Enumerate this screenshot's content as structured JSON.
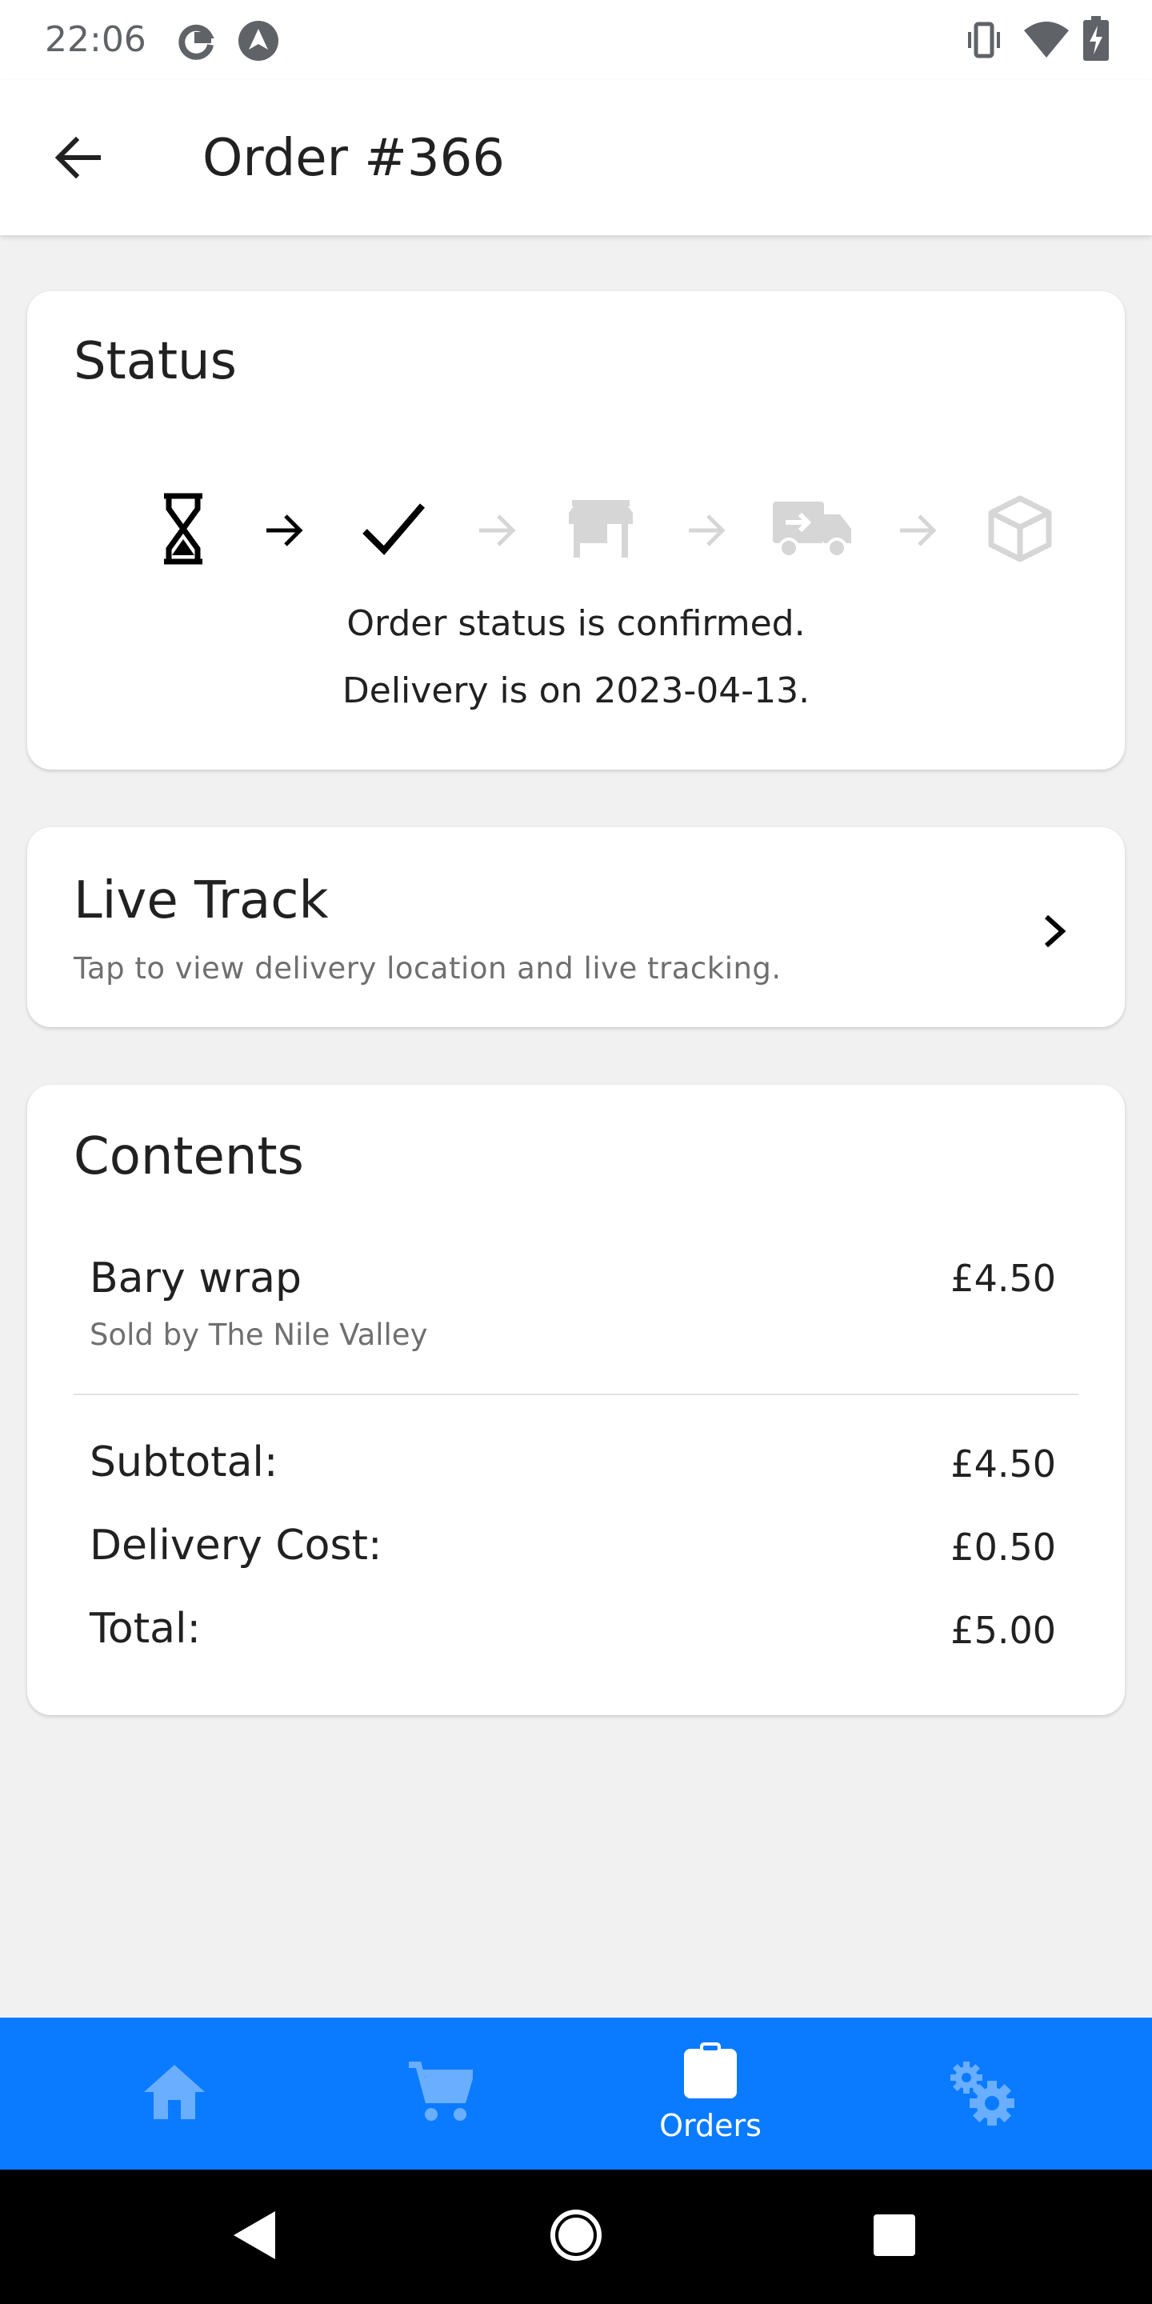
{
  "status_bar": {
    "time": "22:06",
    "left_icons": [
      "google-icon",
      "android-auto-icon"
    ],
    "right_icons": [
      "vibrate-icon",
      "wifi-icon",
      "battery-charging-icon"
    ]
  },
  "app_bar": {
    "back_icon": "arrow-back-icon",
    "title": "Order #366"
  },
  "status_card": {
    "title": "Status",
    "steps": [
      {
        "icon": "hourglass-icon",
        "state": "done"
      },
      {
        "icon": "arrow-right-icon",
        "state": "done"
      },
      {
        "icon": "check-icon",
        "state": "current"
      },
      {
        "icon": "arrow-right-icon",
        "state": "pending"
      },
      {
        "icon": "store-icon",
        "state": "pending"
      },
      {
        "icon": "arrow-right-icon",
        "state": "pending"
      },
      {
        "icon": "delivery-truck-icon",
        "state": "pending"
      },
      {
        "icon": "arrow-right-icon",
        "state": "pending"
      },
      {
        "icon": "package-icon",
        "state": "pending"
      }
    ],
    "status_text": "Order status is confirmed.",
    "delivery_text": "Delivery is on 2023-04-13."
  },
  "live_track": {
    "title": "Live Track",
    "subtitle": "Tap to view delivery location and live tracking.",
    "chevron_icon": "chevron-right-icon"
  },
  "contents": {
    "title": "Contents",
    "items": [
      {
        "name": "Bary wrap",
        "seller": "Sold by The Nile Valley",
        "price": "£4.50"
      }
    ],
    "summary": [
      {
        "label": "Subtotal:",
        "value": "£4.50"
      },
      {
        "label": "Delivery Cost:",
        "value": "£0.50"
      },
      {
        "label": "Total:",
        "value": "£5.00"
      }
    ]
  },
  "bottom_nav": {
    "items": [
      {
        "icon": "home-icon",
        "label": "",
        "active": false
      },
      {
        "icon": "cart-icon",
        "label": "",
        "active": false
      },
      {
        "icon": "orders-clipboard-icon",
        "label": "Orders",
        "active": true
      },
      {
        "icon": "settings-icon",
        "label": "",
        "active": false
      }
    ]
  },
  "system_nav": {
    "items": [
      "back-triangle-icon",
      "home-circle-icon",
      "recents-square-icon"
    ]
  },
  "colors": {
    "accent": "#0a7bff",
    "nav_inactive_icon": "#6aaeff",
    "step_pending": "#d6d6d6",
    "background": "#f1f1f1"
  }
}
